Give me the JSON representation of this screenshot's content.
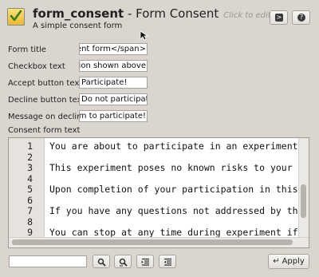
{
  "header": {
    "name": "form_consent",
    "separator": " - ",
    "title": "Form Consent",
    "click_hint": "Click to edit",
    "description": "A simple consent form"
  },
  "toolbar_icons": [
    "console-icon",
    "help-icon"
  ],
  "fields": [
    {
      "label": "Form title",
      "value": "nsent form</span>"
    },
    {
      "label": "Checkbox text",
      "value": "ation shown above"
    },
    {
      "label": "Accept button text",
      "value": "Participate!"
    },
    {
      "label": "Decline button text",
      "value": "Do not participate"
    },
    {
      "label": "Message on decline",
      "value": "orm to participate!"
    }
  ],
  "editor": {
    "label": "Consent form text",
    "line_numbers": [
      "1",
      "2",
      "3",
      "4",
      "5",
      "6",
      "7",
      "8",
      "9"
    ],
    "lines": [
      "You are about to participate in an experiment.",
      "",
      "This experiment poses no known risks to your h",
      "",
      "Upon completion of your participation in this",
      "",
      "If you have any questions not addressed by thi",
      "",
      "You can stop at any time during experiment if"
    ]
  },
  "bottom_bar": {
    "search_value": "",
    "apply_label": "Apply"
  }
}
